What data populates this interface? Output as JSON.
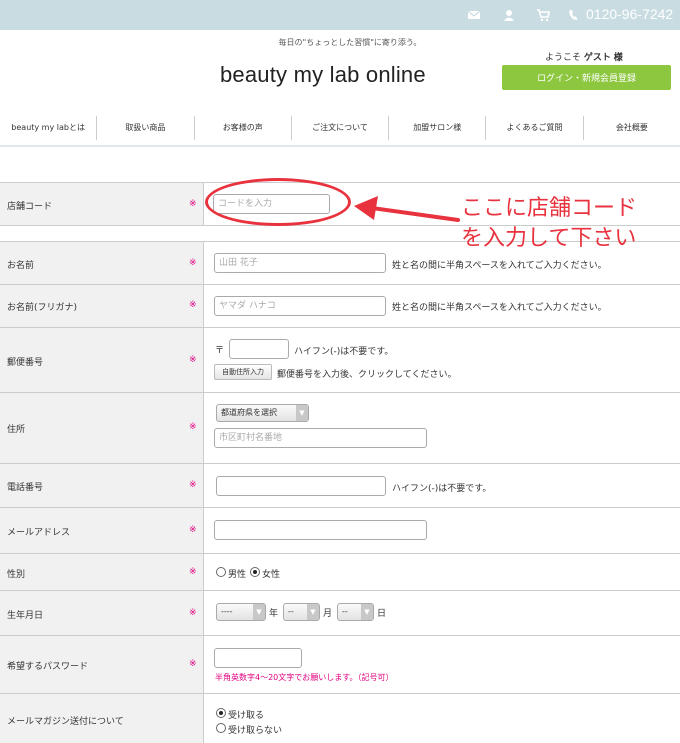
{
  "topbar": {
    "phone": "0120-96-7242"
  },
  "header": {
    "tagline": "毎日の\"ちょっとした習慣\"に寄り添う。",
    "logo_main": "beauty my lab",
    "logo_suffix": "online",
    "welcome_prefix": "ようこそ",
    "welcome_name": "ゲスト",
    "welcome_suffix": "様",
    "login_button": "ログイン・新規会員登録"
  },
  "nav": {
    "items": [
      "beauty my labとは",
      "取扱い商品",
      "お客様の声",
      "ご注文について",
      "加盟サロン様",
      "よくあるご質問",
      "会社概要"
    ]
  },
  "form": {
    "required_mark": "※",
    "store_code": {
      "label": "店舗コード",
      "placeholder": "コードを入力"
    },
    "name": {
      "label": "お名前",
      "placeholder": "山田 花子",
      "note": "姓と名の間に半角スペースを入れてご入力ください。"
    },
    "kana": {
      "label": "お名前(フリガナ)",
      "placeholder": "ヤマダ ハナコ",
      "note": "姓と名の間に半角スペースを入れてご入力ください。"
    },
    "postal": {
      "label": "郵便番号",
      "prefix": "〒",
      "note": "ハイフン(-)は不要です。",
      "auto_button": "自動住所入力",
      "auto_note": "郵便番号を入力後、クリックしてください。"
    },
    "address": {
      "label": "住所",
      "prefecture": "都道府県を選択",
      "placeholder": "市区町村名番地"
    },
    "phone": {
      "label": "電話番号",
      "note": "ハイフン(-)は不要です。"
    },
    "email": {
      "label": "メールアドレス"
    },
    "gender": {
      "label": "性別",
      "male": "男性",
      "female": "女性",
      "selected": "female"
    },
    "birthday": {
      "label": "生年月日",
      "year": "----",
      "month": "--",
      "day": "--",
      "year_unit": "年",
      "month_unit": "月",
      "day_unit": "日"
    },
    "password": {
      "label": "希望するパスワード",
      "hint": "半角英数字4〜20文字でお願いします。（記号可）"
    },
    "newsletter": {
      "label": "メールマガジン送付について",
      "opt_in": "受け取る",
      "opt_out": "受け取らない",
      "selected": "opt_in"
    }
  },
  "annotation": {
    "line1": "ここに店舗コード",
    "line2": "を入力して下さい",
    "color": "#e8333f"
  }
}
